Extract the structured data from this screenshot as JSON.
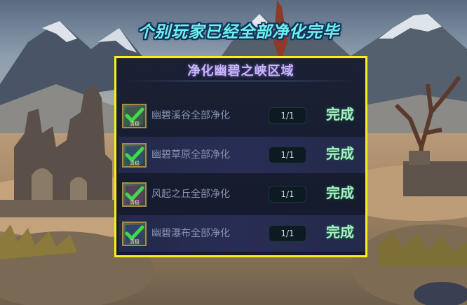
{
  "headline": "个别玩家已经全部净化完毕",
  "panel": {
    "title": "净化幽碧之峡区域",
    "rows": [
      {
        "name": "幽碧溪谷全部净化",
        "progress": "1/1",
        "status": "完成",
        "icon": "check-badge-icon",
        "icon_caption": "清稳"
      },
      {
        "name": "幽碧草原全部净化",
        "progress": "1/1",
        "status": "完成",
        "icon": "check-badge-icon",
        "icon_caption": "清稳"
      },
      {
        "name": "风起之丘全部净化",
        "progress": "1/1",
        "status": "完成",
        "icon": "check-badge-icon",
        "icon_caption": "清稳"
      },
      {
        "name": "幽碧瀑布全部净化",
        "progress": "1/1",
        "status": "完成",
        "icon": "check-badge-icon",
        "icon_caption": "清稳"
      }
    ]
  },
  "colors": {
    "headline": "#6cf2ec",
    "panel_border": "#f7f019",
    "panel_title": "#c5b8f3",
    "done_text": "#a8f0c5",
    "check": "#3fd94a"
  }
}
